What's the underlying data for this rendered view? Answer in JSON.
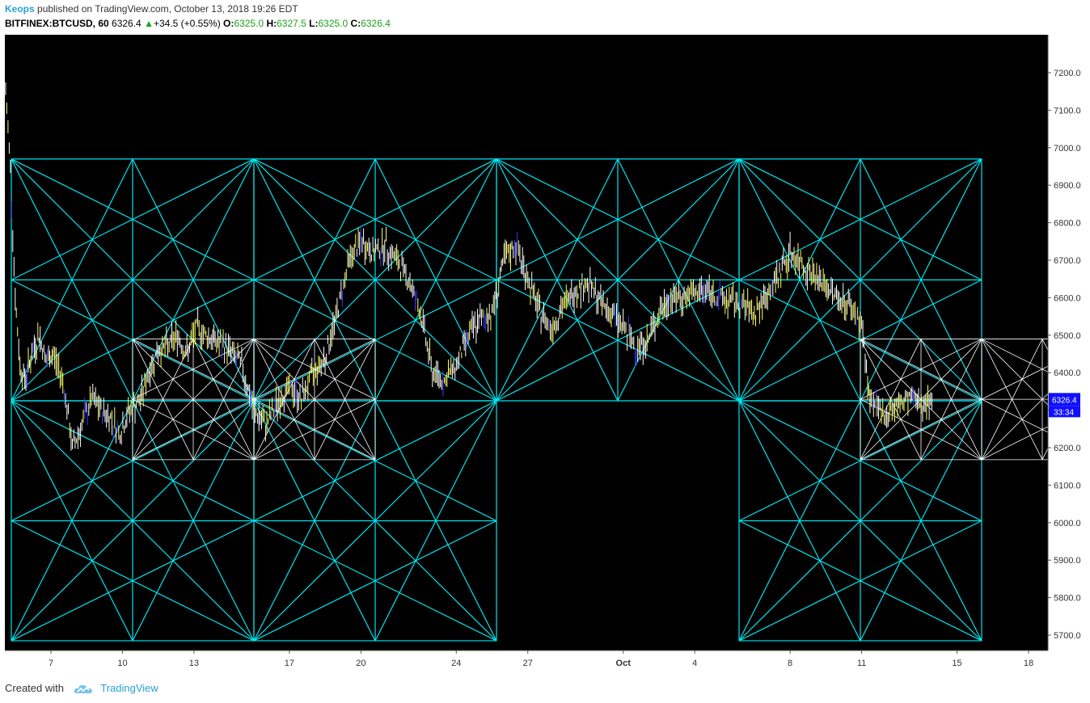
{
  "header": {
    "author": "Keops",
    "published_text": "published on TradingView.com, October 13, 2018 19:26 EDT",
    "symbol": "BITFINEX:BTCUSD, 60",
    "last": "6326.4",
    "change_arrow": "▲",
    "change": "+34.5 (+0.55%)",
    "o_label": "O:",
    "o_value": "6325.0",
    "h_label": "H:",
    "h_value": "6327.5",
    "l_label": "L:",
    "l_value": "6325.0",
    "c_label": "C:",
    "c_value": "6326.4"
  },
  "price_tag": {
    "price": "6326.4",
    "countdown": "33:34"
  },
  "footer": {
    "created_with": "Created with",
    "brand": "TradingView",
    "icon": "tradingview-cloud-icon"
  },
  "colors": {
    "background": "#000000",
    "gann": "#00e5ee",
    "gann_small": "#ffffff",
    "candle_up": "#ffffff",
    "candle_down": "#ffff66",
    "candle_wick_blue": "#3a3aff",
    "axis_text": "#333333",
    "tag_bg": "#1010ff"
  },
  "chart_data": {
    "type": "line",
    "title": "BITFINEX:BTCUSD, 60",
    "y_ticks": [
      "7200.0",
      "7100.0",
      "7000.0",
      "6900.0",
      "6800.0",
      "6700.0",
      "6600.0",
      "6500.0",
      "6400.0",
      "6300.0",
      "6200.0",
      "6100.0",
      "6000.0",
      "5900.0",
      "5800.0",
      "5700.0"
    ],
    "x_ticks": [
      "7",
      "10",
      "13",
      "17",
      "20",
      "24",
      "27",
      "Oct",
      "4",
      "8",
      "11",
      "15",
      "18"
    ],
    "ylim": [
      5650,
      7300
    ],
    "x_range_days": [
      5,
      49
    ],
    "x_tick_days": [
      7,
      10,
      13,
      17,
      20,
      24,
      27,
      31,
      34,
      38,
      41,
      45,
      48
    ],
    "gann_levels": [
      6970,
      6650,
      6325,
      6005,
      5685
    ],
    "gann_small_levels": [
      6490,
      6168
    ],
    "series": [
      {
        "x": [
          5.1,
          5.3,
          5.5,
          5.7,
          5.9,
          6.2,
          6.5,
          6.8,
          7.1,
          7.5,
          7.9,
          8.3,
          8.7,
          9.1,
          9.5,
          9.9,
          10.3,
          10.7,
          11.1,
          11.5,
          11.9,
          12.3,
          12.7,
          13.1,
          13.5,
          14.0,
          14.5,
          15.0,
          15.5,
          16.0,
          16.5,
          17.0,
          17.5,
          18.0,
          18.5,
          19.0,
          19.5,
          20.0,
          20.5,
          21.0,
          21.5,
          22.0,
          22.5,
          23.0,
          23.5,
          24.0,
          24.5,
          25.0,
          25.5,
          26.0,
          26.5,
          27.0,
          27.5,
          28.0,
          28.5,
          29.0,
          29.5,
          30.0,
          30.5,
          31.0,
          31.5,
          32.0,
          32.5,
          33.0,
          33.5,
          34.0,
          34.5,
          35.0,
          35.5,
          36.0,
          36.5,
          37.0,
          37.5,
          38.0,
          38.5,
          39.0,
          39.5,
          40.0,
          40.5,
          41.0,
          41.3,
          41.6,
          42.0,
          42.5,
          43.0,
          43.5,
          44.0
        ],
        "y": [
          7150,
          6950,
          6600,
          6420,
          6380,
          6450,
          6500,
          6430,
          6450,
          6380,
          6200,
          6260,
          6330,
          6300,
          6280,
          6240,
          6300,
          6320,
          6400,
          6460,
          6470,
          6500,
          6450,
          6520,
          6500,
          6480,
          6460,
          6420,
          6300,
          6260,
          6320,
          6360,
          6330,
          6400,
          6440,
          6560,
          6700,
          6750,
          6720,
          6740,
          6700,
          6650,
          6560,
          6400,
          6380,
          6420,
          6500,
          6540,
          6560,
          6700,
          6740,
          6650,
          6560,
          6520,
          6580,
          6620,
          6640,
          6590,
          6560,
          6520,
          6470,
          6480,
          6560,
          6600,
          6600,
          6610,
          6620,
          6600,
          6590,
          6580,
          6560,
          6600,
          6660,
          6720,
          6690,
          6660,
          6630,
          6600,
          6580,
          6530,
          6340,
          6300,
          6290,
          6310,
          6330,
          6320,
          6326
        ]
      }
    ]
  }
}
